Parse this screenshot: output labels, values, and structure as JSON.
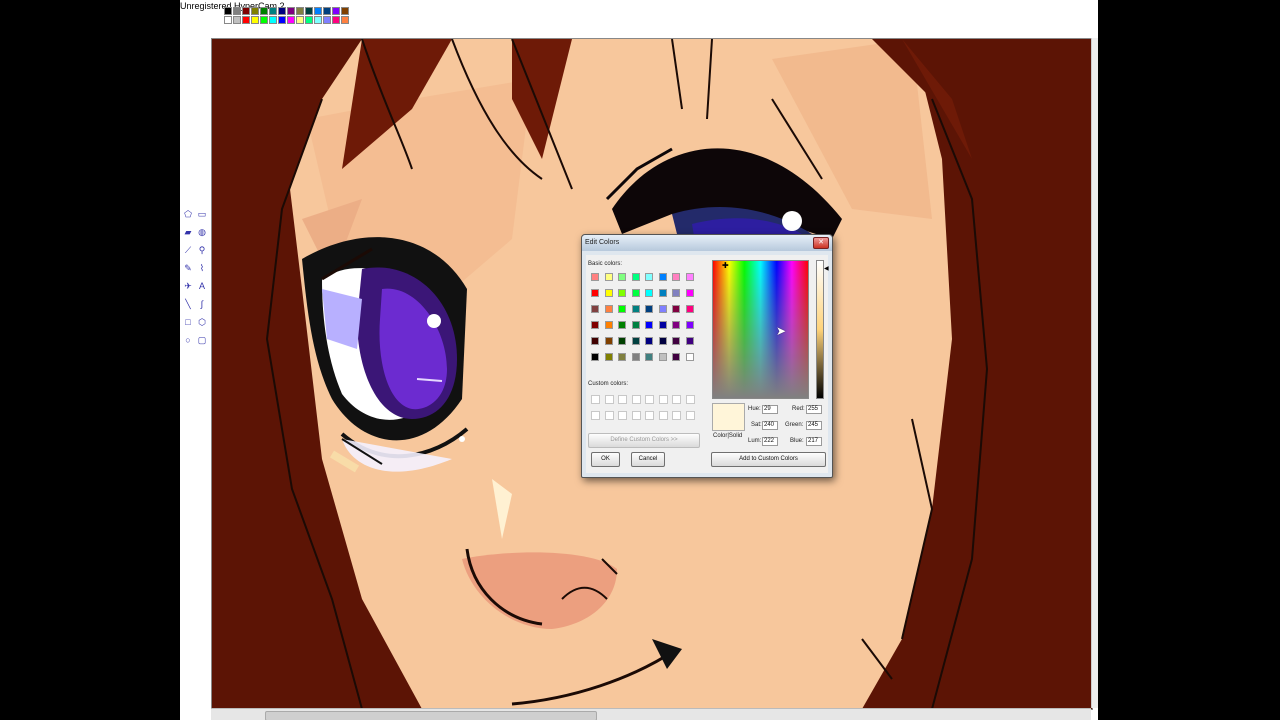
{
  "watermark": "Unregistered HyperCam 2",
  "palette": {
    "top": [
      "#000000",
      "#808080",
      "#800000",
      "#808000",
      "#008000",
      "#008080",
      "#000080",
      "#800080",
      "#808040",
      "#004040",
      "#0080ff",
      "#004080",
      "#8000ff",
      "#804000"
    ],
    "bottom": [
      "#ffffff",
      "#c0c0c0",
      "#ff0000",
      "#ffff00",
      "#00ff00",
      "#00ffff",
      "#0000ff",
      "#ff00ff",
      "#ffff80",
      "#00ff80",
      "#80ffff",
      "#8080ff",
      "#ff0080",
      "#ff8040"
    ]
  },
  "toolbox": {
    "tools": [
      {
        "name": "free-select-icon",
        "glyph": "⬠"
      },
      {
        "name": "rect-select-icon",
        "glyph": "▭"
      },
      {
        "name": "eraser-icon",
        "glyph": "▰"
      },
      {
        "name": "fill-icon",
        "glyph": "◍"
      },
      {
        "name": "picker-icon",
        "glyph": "⟋"
      },
      {
        "name": "magnifier-icon",
        "glyph": "⚲"
      },
      {
        "name": "pencil-icon",
        "glyph": "✎"
      },
      {
        "name": "brush-icon",
        "glyph": "⌇"
      },
      {
        "name": "airbrush-icon",
        "glyph": "✈"
      },
      {
        "name": "text-icon",
        "glyph": "A"
      },
      {
        "name": "line-icon",
        "glyph": "╲"
      },
      {
        "name": "curve-icon",
        "glyph": "∫"
      },
      {
        "name": "rectangle-icon",
        "glyph": "□"
      },
      {
        "name": "polygon-icon",
        "glyph": "⬡"
      },
      {
        "name": "ellipse-icon",
        "glyph": "○"
      },
      {
        "name": "rounded-rect-icon",
        "glyph": "▢"
      }
    ]
  },
  "dialog": {
    "title": "Edit Colors",
    "close_glyph": "✕",
    "basic_colors_label": "Basic colors:",
    "custom_colors_label": "Custom colors:",
    "define_custom_button": "Define Custom Colors >>",
    "ok_button": "OK",
    "cancel_button": "Cancel",
    "add_custom_button": "Add to Custom Colors",
    "color_solid_label": "Color|Solid",
    "crosshair_glyph": "✚",
    "lum_arrow_glyph": "◀",
    "color_solid": "#fff5d9",
    "fields": {
      "hue_label": "Hue:",
      "hue": "29",
      "sat_label": "Sat:",
      "sat": "240",
      "lum_label": "Lum:",
      "lum": "222",
      "red_label": "Red:",
      "red": "255",
      "green_label": "Green:",
      "green": "245",
      "blue_label": "Blue:",
      "blue": "217"
    },
    "basic_colors": [
      [
        "#ff8080",
        "#ffff80",
        "#80ff80",
        "#00ff80",
        "#80ffff",
        "#0080ff",
        "#ff80c0",
        "#ff80ff"
      ],
      [
        "#ff0000",
        "#ffff00",
        "#80ff00",
        "#00ff40",
        "#00ffff",
        "#0080c0",
        "#8080c0",
        "#ff00ff"
      ],
      [
        "#804040",
        "#ff8040",
        "#00ff00",
        "#008080",
        "#004080",
        "#8080ff",
        "#800040",
        "#ff0080"
      ],
      [
        "#800000",
        "#ff8000",
        "#008000",
        "#008040",
        "#0000ff",
        "#0000a0",
        "#800080",
        "#8000ff"
      ],
      [
        "#400000",
        "#804000",
        "#004000",
        "#004040",
        "#000080",
        "#000040",
        "#400040",
        "#400080"
      ],
      [
        "#000000",
        "#808000",
        "#808040",
        "#808080",
        "#408080",
        "#c0c0c0",
        "#400040",
        "#ffffff"
      ]
    ]
  }
}
